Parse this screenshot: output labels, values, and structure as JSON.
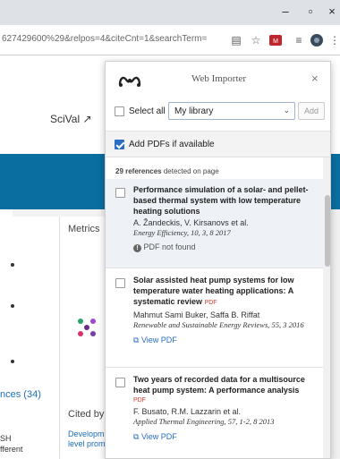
{
  "browser": {
    "url": "627429600%29&relpos=4&citeCnt=1&searchTerm=",
    "window_controls": {
      "minimize": "–",
      "maximize": "▫",
      "close": "×"
    }
  },
  "background_page": {
    "scival_link": "SciVal ↗",
    "metrics_heading": "Metrics",
    "references_link": "nces (34)",
    "cited_by_heading": "Cited by",
    "cited_item_line1": "Developm",
    "cited_item_line2": "level prom",
    "left_small_1": "SH",
    "left_small_2": "fferent"
  },
  "importer": {
    "title": "Web Importer",
    "close_label": "×",
    "select_all_label": "Select all",
    "library_selected": "My library",
    "add_button": "Add",
    "add_pdfs_label": "Add PDFs if available",
    "add_pdfs_checked": true,
    "ref_count_number": "29 references",
    "ref_count_suffix": "detected on page",
    "references": [
      {
        "title": "Performance simulation of a solar- and pellet-based thermal system with low temperature heating solutions",
        "authors": "A. Žandeckis, V. Kirsanovs et al.",
        "journal": "Energy Efficiency, 10, 3, 8 2017",
        "status": "PDF not found",
        "pdf_tag": "",
        "highlighted": true
      },
      {
        "title": "Solar assisted heat pump systems for low temperature water heating applications: A systematic review",
        "authors": "Mahmut Sami Buker, Saffa B. Riffat",
        "journal": "Renewable and Sustainable Energy Reviews, 55, 3 2016",
        "status": "View PDF",
        "pdf_tag": "PDF",
        "highlighted": false
      },
      {
        "title": "Two years of recorded data for a multisource heat pump system: A performance analysis",
        "authors": "F. Busato, R.M. Lazzarin et al.",
        "journal": "Applied Thermal Engineering, 57, 1-2, 8 2013",
        "status": "View PDF",
        "pdf_tag": "PDF",
        "highlighted": false
      }
    ]
  },
  "colors": {
    "accent_blue": "#2a6ec3",
    "brand_band": "#0a6fa0",
    "pdf_red": "#d33a2c"
  }
}
